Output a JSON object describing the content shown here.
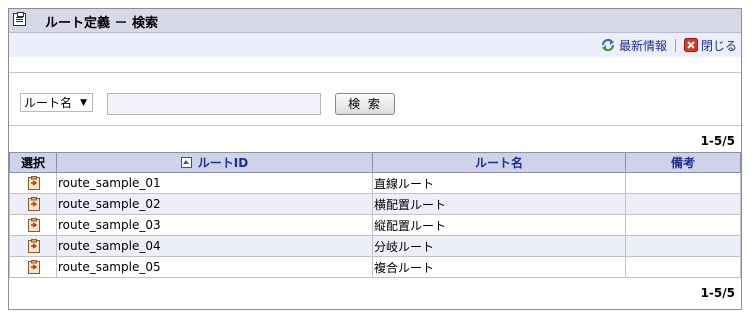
{
  "window": {
    "title": "ルート定義 － 検索"
  },
  "toolbar": {
    "refresh_label": "最新情報",
    "close_label": "閉じる"
  },
  "search": {
    "field_selected": "ルート名",
    "query_value": "",
    "button_label": "検 索"
  },
  "pagination": {
    "top": "1-5/5",
    "bottom": "1-5/5"
  },
  "table": {
    "headers": {
      "select": "選択",
      "route_id": "ルートID",
      "route_name": "ルート名",
      "notes": "備考"
    },
    "sort": {
      "column": "route_id",
      "direction": "ascending"
    },
    "rows": [
      {
        "route_id": "route_sample_01",
        "route_name": "直線ルート",
        "notes": ""
      },
      {
        "route_id": "route_sample_02",
        "route_name": "横配置ルート",
        "notes": ""
      },
      {
        "route_id": "route_sample_03",
        "route_name": "縦配置ルート",
        "notes": ""
      },
      {
        "route_id": "route_sample_04",
        "route_name": "分岐ルート",
        "notes": ""
      },
      {
        "route_id": "route_sample_05",
        "route_name": "複合ルート",
        "notes": ""
      }
    ]
  },
  "icons": {
    "title": "clipboard-icon",
    "refresh": "refresh-icon",
    "close": "close-icon",
    "row_select": "select-document-icon",
    "sort": "sort-ascending-icon"
  }
}
